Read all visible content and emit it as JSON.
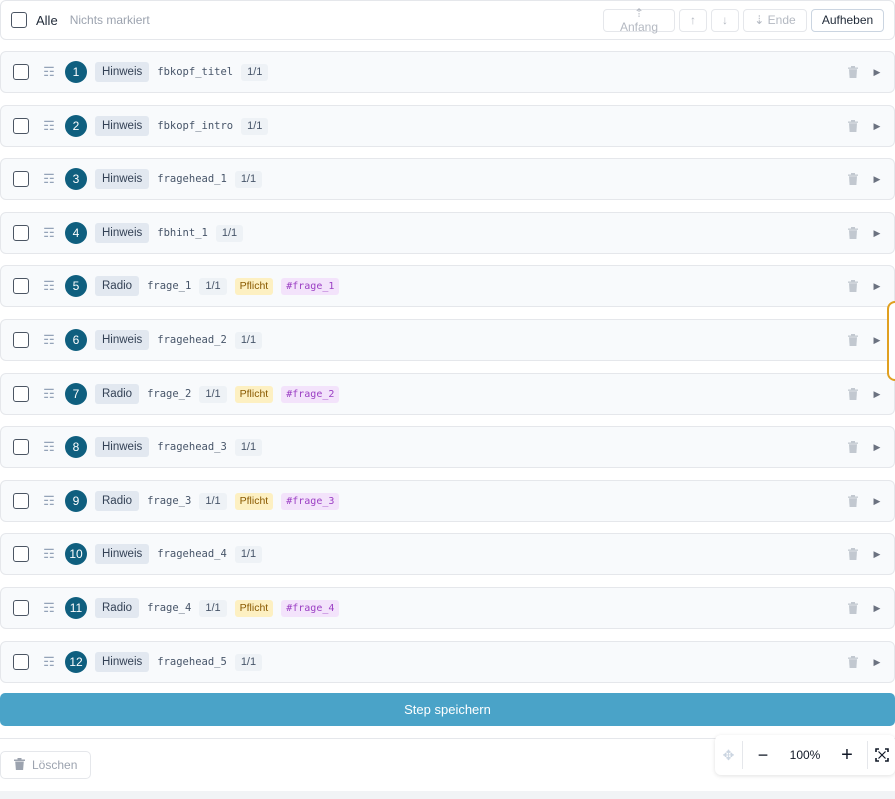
{
  "toolbar": {
    "all_label": "Alle",
    "selection_status": "Nichts markiert",
    "to_start_label": "⇡ Anfang",
    "up_label": "↑",
    "down_label": "↓",
    "to_end_label": "⇣ Ende",
    "cancel_label": "Aufheben"
  },
  "rows": [
    {
      "num": "1",
      "type": "Hinweis",
      "key": "fbkopf_titel",
      "count": "1/1",
      "required": "",
      "var": ""
    },
    {
      "num": "2",
      "type": "Hinweis",
      "key": "fbkopf_intro",
      "count": "1/1",
      "required": "",
      "var": ""
    },
    {
      "num": "3",
      "type": "Hinweis",
      "key": "fragehead_1",
      "count": "1/1",
      "required": "",
      "var": ""
    },
    {
      "num": "4",
      "type": "Hinweis",
      "key": "fbhint_1",
      "count": "1/1",
      "required": "",
      "var": ""
    },
    {
      "num": "5",
      "type": "Radio",
      "key": "frage_1",
      "count": "1/1",
      "required": "Pflicht",
      "var": "#frage_1"
    },
    {
      "num": "6",
      "type": "Hinweis",
      "key": "fragehead_2",
      "count": "1/1",
      "required": "",
      "var": ""
    },
    {
      "num": "7",
      "type": "Radio",
      "key": "frage_2",
      "count": "1/1",
      "required": "Pflicht",
      "var": "#frage_2"
    },
    {
      "num": "8",
      "type": "Hinweis",
      "key": "fragehead_3",
      "count": "1/1",
      "required": "",
      "var": ""
    },
    {
      "num": "9",
      "type": "Radio",
      "key": "frage_3",
      "count": "1/1",
      "required": "Pflicht",
      "var": "#frage_3"
    },
    {
      "num": "10",
      "type": "Hinweis",
      "key": "fragehead_4",
      "count": "1/1",
      "required": "",
      "var": ""
    },
    {
      "num": "11",
      "type": "Radio",
      "key": "frage_4",
      "count": "1/1",
      "required": "Pflicht",
      "var": "#frage_4"
    },
    {
      "num": "12",
      "type": "Hinweis",
      "key": "fragehead_5",
      "count": "1/1",
      "required": "",
      "var": ""
    }
  ],
  "footer": {
    "save_label": "Step speichern",
    "delete_label": "Löschen"
  },
  "zoom": {
    "minus_label": "−",
    "level": "100%",
    "plus_label": "+"
  },
  "colors": {
    "accent": "#4aa3c8",
    "number_badge": "#0f5f7f",
    "required_badge": "#fdf0c2",
    "variable_badge": "#f3e3fb",
    "handle_border": "#e0a020"
  }
}
